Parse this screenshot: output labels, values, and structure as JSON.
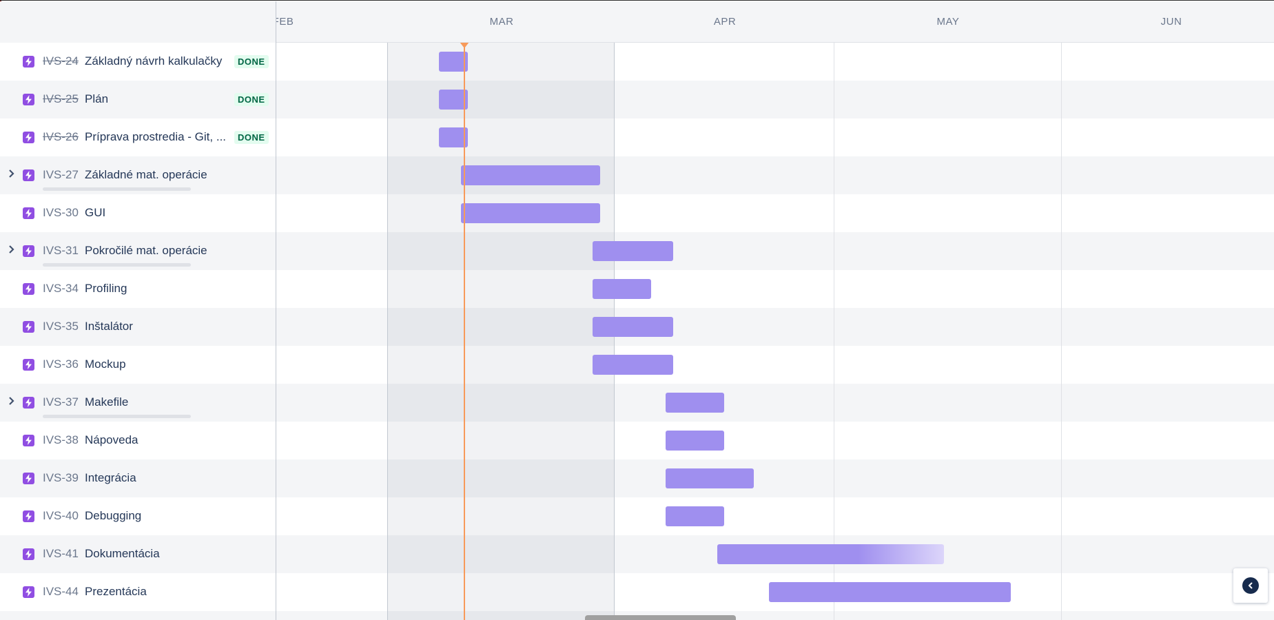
{
  "timeline": {
    "months": [
      "FEB",
      "MAR",
      "APR",
      "MAY",
      "JUN"
    ]
  },
  "issues": [
    {
      "key": "IVS-24",
      "summary": "Základný návrh kalkulačky",
      "status": "DONE",
      "done": true,
      "expandable": false
    },
    {
      "key": "IVS-25",
      "summary": "Plán",
      "status": "DONE",
      "done": true,
      "expandable": false
    },
    {
      "key": "IVS-26",
      "summary": "Príprava prostredia - Git, ...",
      "status": "DONE",
      "done": true,
      "expandable": false
    },
    {
      "key": "IVS-27",
      "summary": "Základné mat. operácie",
      "status": "",
      "done": false,
      "expandable": true
    },
    {
      "key": "IVS-30",
      "summary": "GUI",
      "status": "",
      "done": false,
      "expandable": false
    },
    {
      "key": "IVS-31",
      "summary": "Pokročilé mat. operácie",
      "status": "",
      "done": false,
      "expandable": true
    },
    {
      "key": "IVS-34",
      "summary": "Profiling",
      "status": "",
      "done": false,
      "expandable": false
    },
    {
      "key": "IVS-35",
      "summary": "Inštalátor",
      "status": "",
      "done": false,
      "expandable": false
    },
    {
      "key": "IVS-36",
      "summary": "Mockup",
      "status": "",
      "done": false,
      "expandable": false
    },
    {
      "key": "IVS-37",
      "summary": "Makefile",
      "status": "",
      "done": false,
      "expandable": true
    },
    {
      "key": "IVS-38",
      "summary": "Nápoveda",
      "status": "",
      "done": false,
      "expandable": false
    },
    {
      "key": "IVS-39",
      "summary": "Integrácia",
      "status": "",
      "done": false,
      "expandable": false
    },
    {
      "key": "IVS-40",
      "summary": "Debugging",
      "status": "",
      "done": false,
      "expandable": false
    },
    {
      "key": "IVS-41",
      "summary": "Dokumentácia",
      "status": "",
      "done": false,
      "expandable": false
    },
    {
      "key": "IVS-44",
      "summary": "Prezentácia",
      "status": "",
      "done": false,
      "expandable": false
    }
  ],
  "colors": {
    "bar": "#9f8fef",
    "today_line": "#f79a5a",
    "epic_icon": "#904ee2",
    "done_lozenge_bg": "#e3fcef",
    "done_lozenge_text": "#006644"
  },
  "icons": {
    "issue_type": "lightning-bolt-icon",
    "expand": "chevron-right-icon",
    "collapse_panel": "chevron-left-icon"
  }
}
